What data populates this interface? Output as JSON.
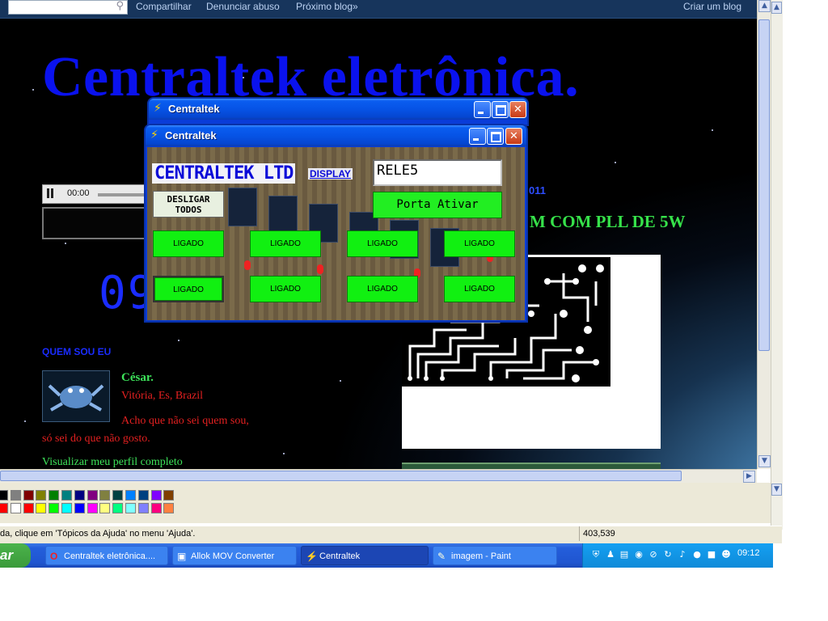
{
  "blog": {
    "search_placeholder": "",
    "nav_links": [
      "Compartilhar",
      "Denunciar abuso",
      "Próximo blog»"
    ],
    "create_blog": "Criar um blog",
    "title": "Centraltek eletrônica.",
    "player_time": "00:00",
    "big_digits": "09",
    "date_fragment": "011",
    "post_title_fragment": "M COM PLL DE 5W",
    "profile": {
      "heading": "QUEM SOU EU",
      "name": "César.",
      "location": "Vitória, Es, Brazil",
      "desc_line1": "Acho que não sei quem sou,",
      "desc_line2": "só sei do que não gosto.",
      "view_link": "Visualizar meu perfil completo"
    }
  },
  "app_back": {
    "title": "Centraltek"
  },
  "app": {
    "title": "Centraltek",
    "logo": "CENTRALTEK LTD",
    "display_label": "DISPLAY",
    "display_value": "RELE5",
    "porta_button": "Porta Ativar",
    "desligar_line1": "DESLIGAR",
    "desligar_line2": "TODOS",
    "relay_buttons": [
      "LIGADO",
      "LIGADO",
      "LIGADO",
      "LIGADO",
      "LIGADO",
      "LIGADO",
      "LIGADO",
      "LIGADO"
    ]
  },
  "paint": {
    "status_text": "da, clique em 'Tópicos da Ajuda' no menu 'Ajuda'.",
    "coords": "403,539",
    "palette_row1": [
      "#000000",
      "#808080",
      "#800000",
      "#808000",
      "#008000",
      "#008080",
      "#000080",
      "#800080",
      "#808040",
      "#004040",
      "#0080ff",
      "#004080",
      "#8000ff",
      "#804000"
    ],
    "palette_row2": [
      "#ff0000",
      "#ffffff",
      "#ff0000",
      "#ffff00",
      "#00ff00",
      "#00ffff",
      "#0000ff",
      "#ff00ff",
      "#ffff80",
      "#00ff80",
      "#80ffff",
      "#8080ff",
      "#ff0080",
      "#ff8040"
    ]
  },
  "taskbar": {
    "start_label": "ar",
    "tasks": [
      {
        "label": "Centraltek eletrônica....",
        "icon": "opera-icon",
        "active": false
      },
      {
        "label": "Allok MOV Converter",
        "icon": "window-icon",
        "active": false
      },
      {
        "label": "Centraltek",
        "icon": "lightning-icon",
        "active": true
      },
      {
        "label": "imagem - Paint",
        "icon": "paint-icon",
        "active": false
      }
    ],
    "clock": "09:12"
  }
}
